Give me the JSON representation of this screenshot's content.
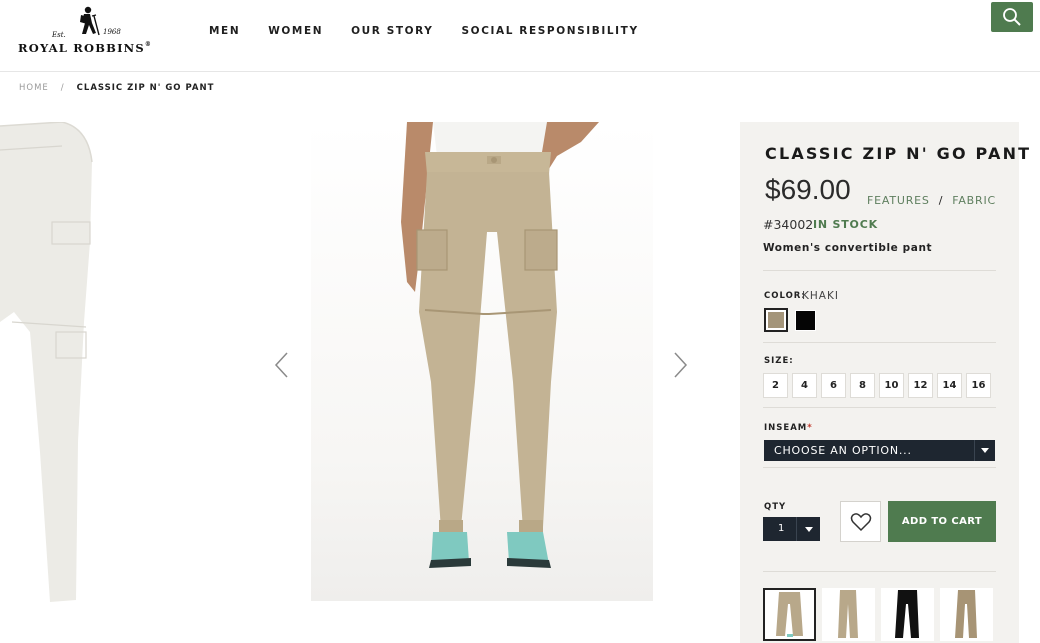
{
  "brand": {
    "est": "Est.",
    "year": "1968",
    "name": "ROYAL ROBBINS",
    "name_suffix": "®"
  },
  "nav": {
    "items": [
      {
        "label": "MEN"
      },
      {
        "label": "WOMEN"
      },
      {
        "label": "OUR STORY"
      },
      {
        "label": "SOCIAL RESPONSIBILITY"
      }
    ]
  },
  "breadcrumb": {
    "home": "HOME",
    "separator": "/",
    "current": "CLASSIC ZIP N' GO PANT"
  },
  "product": {
    "title": "CLASSIC ZIP N' GO PANT",
    "price": "$69.00",
    "links": {
      "features": "FEATURES",
      "separator": "/",
      "fabric": "FABRIC"
    },
    "sku": "#34002",
    "stock": "IN STOCK",
    "description": "Women's convertible pant",
    "color_label": "COLOR:",
    "color_value": "KHAKI",
    "colors": [
      {
        "name": "khaki",
        "hex": "#a4957a"
      },
      {
        "name": "black",
        "hex": "#050505"
      }
    ],
    "size_label": "SIZE:",
    "sizes": [
      "2",
      "4",
      "6",
      "8",
      "10",
      "12",
      "14",
      "16"
    ],
    "inseam_label": "INSEAM",
    "inseam_required": "*",
    "inseam_placeholder": "CHOOSE AN OPTION...",
    "qty_label": "QTY",
    "qty_value": "1",
    "add_to_cart": "ADD TO CART",
    "thumbnails": [
      {
        "name": "khaki-front",
        "color": "#b8a88a"
      },
      {
        "name": "khaki-side",
        "color": "#b8a88a"
      },
      {
        "name": "black-front",
        "color": "#111111"
      },
      {
        "name": "khaki-back",
        "color": "#a79475"
      }
    ]
  },
  "colors": {
    "accent_green": "#4f7b4f",
    "panel_bg": "#f3f2ef",
    "dark_select": "#1e2630",
    "pant_khaki": "#c3b394"
  },
  "icons": {
    "search": "search-icon",
    "wishlist": "heart-icon",
    "prev": "chevron-left-icon",
    "next": "chevron-right-icon",
    "caret": "caret-down-icon"
  }
}
